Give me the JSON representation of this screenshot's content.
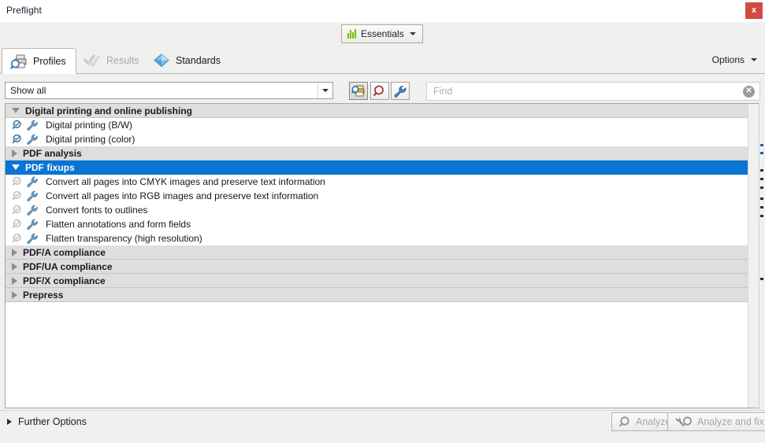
{
  "window": {
    "title": "Preflight",
    "close_label": "x",
    "close_icon": "close-icon",
    "close_color": "#d24a43"
  },
  "header": {
    "essentials": {
      "label": "Essentials",
      "icon": "bar-chart-icon",
      "icon_color": "#7dbb00",
      "dropdown_icon": "caret-down-icon"
    }
  },
  "tabs": [
    {
      "label": "Profiles",
      "icon": "printer-magnifier-icon",
      "active": true,
      "disabled": false
    },
    {
      "label": "Results",
      "icon": "checkmarks-icon",
      "active": false,
      "disabled": true
    },
    {
      "label": "Standards",
      "icon": "blue-diamond-icon",
      "active": false,
      "disabled": false
    }
  ],
  "options_menu": {
    "label": "Options",
    "icon": "caret-down-icon"
  },
  "filter_bar": {
    "filter_select": {
      "value": "Show all",
      "icon": "chevron-down-icon"
    },
    "tool_buttons": [
      {
        "name": "profile-tool-button",
        "icon": "printer-magnifier-icon",
        "active": true
      },
      {
        "name": "check-tool-button",
        "icon": "magnifier-icon",
        "active": false
      },
      {
        "name": "fix-tool-button",
        "icon": "wrench-icon",
        "active": false
      }
    ],
    "search": {
      "placeholder": "Find",
      "value": "",
      "clear_icon": "clear-circle-icon",
      "clear_label": "✕"
    }
  },
  "profile_list": {
    "selection_color": "#0a74d4",
    "groups": [
      {
        "label": "Digital printing and online publishing",
        "expanded": true,
        "selected": false,
        "items": [
          {
            "label": "Digital printing (B/W)",
            "check_icon": "magnifier-check-icon",
            "fix_icon": "wrench-icon",
            "check_enabled": true,
            "fix_enabled": true
          },
          {
            "label": "Digital printing (color)",
            "check_icon": "magnifier-check-icon",
            "fix_icon": "wrench-icon",
            "check_enabled": true,
            "fix_enabled": true
          }
        ]
      },
      {
        "label": "PDF analysis",
        "expanded": false,
        "selected": false,
        "items": []
      },
      {
        "label": "PDF fixups",
        "expanded": true,
        "selected": true,
        "items": [
          {
            "label": "Convert all pages into CMYK images and preserve text information",
            "check_icon": "magnifier-check-icon",
            "fix_icon": "wrench-icon",
            "check_enabled": false,
            "fix_enabled": true
          },
          {
            "label": "Convert all pages into RGB images and preserve text information",
            "check_icon": "magnifier-check-icon",
            "fix_icon": "wrench-icon",
            "check_enabled": false,
            "fix_enabled": true
          },
          {
            "label": "Convert fonts to outlines",
            "check_icon": "magnifier-check-icon",
            "fix_icon": "wrench-icon",
            "check_enabled": false,
            "fix_enabled": true
          },
          {
            "label": "Flatten annotations and form fields",
            "check_icon": "magnifier-check-icon",
            "fix_icon": "wrench-icon",
            "check_enabled": false,
            "fix_enabled": true
          },
          {
            "label": "Flatten transparency (high resolution)",
            "check_icon": "magnifier-check-icon",
            "fix_icon": "wrench-icon",
            "check_enabled": false,
            "fix_enabled": true
          }
        ]
      },
      {
        "label": "PDF/A compliance",
        "expanded": false,
        "selected": false,
        "items": []
      },
      {
        "label": "PDF/UA compliance",
        "expanded": false,
        "selected": false,
        "items": []
      },
      {
        "label": "PDF/X compliance",
        "expanded": false,
        "selected": false,
        "items": []
      },
      {
        "label": "Prepress",
        "expanded": false,
        "selected": false,
        "items": []
      }
    ]
  },
  "footer": {
    "further_options": {
      "label": "Further Options",
      "icon": "triangle-right-icon",
      "expanded": false
    },
    "buttons": [
      {
        "label": "Analyze",
        "icon": "magnifier-icon",
        "enabled": false
      },
      {
        "label": "Analyze and fix",
        "icon": "magnifier-wrench-icon",
        "enabled": false
      }
    ]
  }
}
